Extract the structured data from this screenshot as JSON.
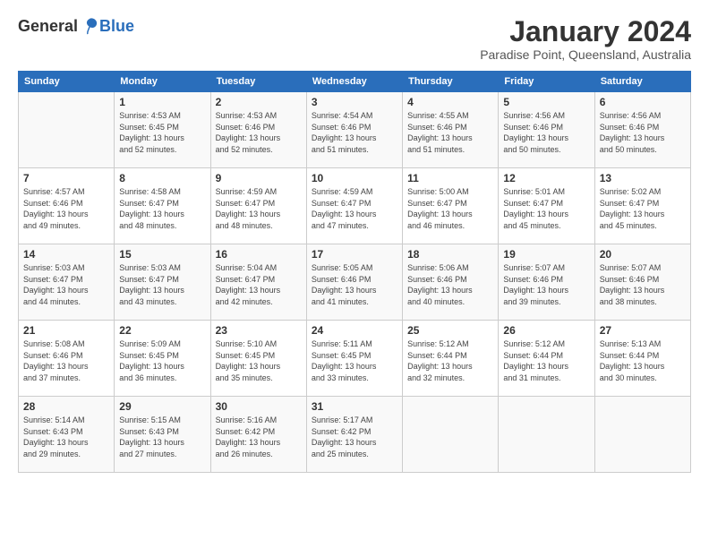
{
  "logo": {
    "general": "General",
    "blue": "Blue"
  },
  "title": "January 2024",
  "location": "Paradise Point, Queensland, Australia",
  "days_of_week": [
    "Sunday",
    "Monday",
    "Tuesday",
    "Wednesday",
    "Thursday",
    "Friday",
    "Saturday"
  ],
  "weeks": [
    [
      {
        "day": "",
        "info": ""
      },
      {
        "day": "1",
        "info": "Sunrise: 4:53 AM\nSunset: 6:45 PM\nDaylight: 13 hours\nand 52 minutes."
      },
      {
        "day": "2",
        "info": "Sunrise: 4:53 AM\nSunset: 6:46 PM\nDaylight: 13 hours\nand 52 minutes."
      },
      {
        "day": "3",
        "info": "Sunrise: 4:54 AM\nSunset: 6:46 PM\nDaylight: 13 hours\nand 51 minutes."
      },
      {
        "day": "4",
        "info": "Sunrise: 4:55 AM\nSunset: 6:46 PM\nDaylight: 13 hours\nand 51 minutes."
      },
      {
        "day": "5",
        "info": "Sunrise: 4:56 AM\nSunset: 6:46 PM\nDaylight: 13 hours\nand 50 minutes."
      },
      {
        "day": "6",
        "info": "Sunrise: 4:56 AM\nSunset: 6:46 PM\nDaylight: 13 hours\nand 50 minutes."
      }
    ],
    [
      {
        "day": "7",
        "info": "Sunrise: 4:57 AM\nSunset: 6:46 PM\nDaylight: 13 hours\nand 49 minutes."
      },
      {
        "day": "8",
        "info": "Sunrise: 4:58 AM\nSunset: 6:47 PM\nDaylight: 13 hours\nand 48 minutes."
      },
      {
        "day": "9",
        "info": "Sunrise: 4:59 AM\nSunset: 6:47 PM\nDaylight: 13 hours\nand 48 minutes."
      },
      {
        "day": "10",
        "info": "Sunrise: 4:59 AM\nSunset: 6:47 PM\nDaylight: 13 hours\nand 47 minutes."
      },
      {
        "day": "11",
        "info": "Sunrise: 5:00 AM\nSunset: 6:47 PM\nDaylight: 13 hours\nand 46 minutes."
      },
      {
        "day": "12",
        "info": "Sunrise: 5:01 AM\nSunset: 6:47 PM\nDaylight: 13 hours\nand 45 minutes."
      },
      {
        "day": "13",
        "info": "Sunrise: 5:02 AM\nSunset: 6:47 PM\nDaylight: 13 hours\nand 45 minutes."
      }
    ],
    [
      {
        "day": "14",
        "info": "Sunrise: 5:03 AM\nSunset: 6:47 PM\nDaylight: 13 hours\nand 44 minutes."
      },
      {
        "day": "15",
        "info": "Sunrise: 5:03 AM\nSunset: 6:47 PM\nDaylight: 13 hours\nand 43 minutes."
      },
      {
        "day": "16",
        "info": "Sunrise: 5:04 AM\nSunset: 6:47 PM\nDaylight: 13 hours\nand 42 minutes."
      },
      {
        "day": "17",
        "info": "Sunrise: 5:05 AM\nSunset: 6:46 PM\nDaylight: 13 hours\nand 41 minutes."
      },
      {
        "day": "18",
        "info": "Sunrise: 5:06 AM\nSunset: 6:46 PM\nDaylight: 13 hours\nand 40 minutes."
      },
      {
        "day": "19",
        "info": "Sunrise: 5:07 AM\nSunset: 6:46 PM\nDaylight: 13 hours\nand 39 minutes."
      },
      {
        "day": "20",
        "info": "Sunrise: 5:07 AM\nSunset: 6:46 PM\nDaylight: 13 hours\nand 38 minutes."
      }
    ],
    [
      {
        "day": "21",
        "info": "Sunrise: 5:08 AM\nSunset: 6:46 PM\nDaylight: 13 hours\nand 37 minutes."
      },
      {
        "day": "22",
        "info": "Sunrise: 5:09 AM\nSunset: 6:45 PM\nDaylight: 13 hours\nand 36 minutes."
      },
      {
        "day": "23",
        "info": "Sunrise: 5:10 AM\nSunset: 6:45 PM\nDaylight: 13 hours\nand 35 minutes."
      },
      {
        "day": "24",
        "info": "Sunrise: 5:11 AM\nSunset: 6:45 PM\nDaylight: 13 hours\nand 33 minutes."
      },
      {
        "day": "25",
        "info": "Sunrise: 5:12 AM\nSunset: 6:44 PM\nDaylight: 13 hours\nand 32 minutes."
      },
      {
        "day": "26",
        "info": "Sunrise: 5:12 AM\nSunset: 6:44 PM\nDaylight: 13 hours\nand 31 minutes."
      },
      {
        "day": "27",
        "info": "Sunrise: 5:13 AM\nSunset: 6:44 PM\nDaylight: 13 hours\nand 30 minutes."
      }
    ],
    [
      {
        "day": "28",
        "info": "Sunrise: 5:14 AM\nSunset: 6:43 PM\nDaylight: 13 hours\nand 29 minutes."
      },
      {
        "day": "29",
        "info": "Sunrise: 5:15 AM\nSunset: 6:43 PM\nDaylight: 13 hours\nand 27 minutes."
      },
      {
        "day": "30",
        "info": "Sunrise: 5:16 AM\nSunset: 6:42 PM\nDaylight: 13 hours\nand 26 minutes."
      },
      {
        "day": "31",
        "info": "Sunrise: 5:17 AM\nSunset: 6:42 PM\nDaylight: 13 hours\nand 25 minutes."
      },
      {
        "day": "",
        "info": ""
      },
      {
        "day": "",
        "info": ""
      },
      {
        "day": "",
        "info": ""
      }
    ]
  ]
}
